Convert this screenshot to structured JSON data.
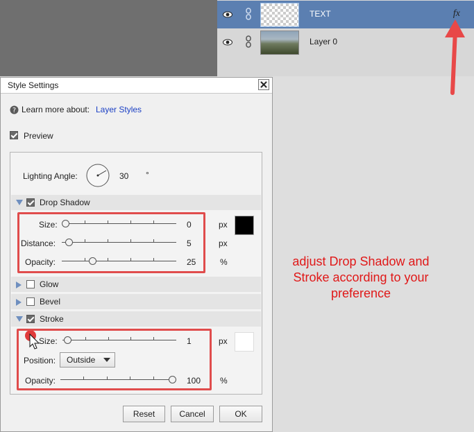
{
  "layers": [
    {
      "name": "TEXT",
      "fx": "fx"
    },
    {
      "name": "Layer 0"
    }
  ],
  "dialog": {
    "title": "Style Settings",
    "learn_more_prefix": "Learn more about:",
    "learn_more_link": "Layer Styles",
    "preview_label": "Preview",
    "lighting_label": "Lighting Angle:",
    "lighting_value": "30",
    "degree_symbol": "°",
    "drop_shadow": {
      "label": "Drop Shadow",
      "size_label": "Size:",
      "size_value": "0",
      "size_unit": "px",
      "size_fraction": 0.0,
      "distance_label": "Distance:",
      "distance_value": "5",
      "distance_unit": "px",
      "distance_fraction": 0.03,
      "opacity_label": "Opacity:",
      "opacity_value": "25",
      "opacity_unit": "%",
      "opacity_fraction": 0.25,
      "color": "#000000"
    },
    "glow_label": "Glow",
    "bevel_label": "Bevel",
    "stroke": {
      "label": "Stroke",
      "size_label": "Size:",
      "size_value": "1",
      "size_unit": "px",
      "size_fraction": 0.01,
      "position_label": "Position:",
      "position_value": "Outside",
      "opacity_label": "Opacity:",
      "opacity_value": "100",
      "opacity_unit": "%",
      "opacity_fraction": 1.0,
      "color": "#ffffff"
    },
    "buttons": {
      "reset": "Reset",
      "cancel": "Cancel",
      "ok": "OK"
    }
  },
  "annotation": "adjust Drop Shadow and Stroke according to your preference",
  "colors": {
    "accent_red": "#e04c4c",
    "selection_blue": "#5b7fb1",
    "link_blue": "#1a3fc4"
  }
}
